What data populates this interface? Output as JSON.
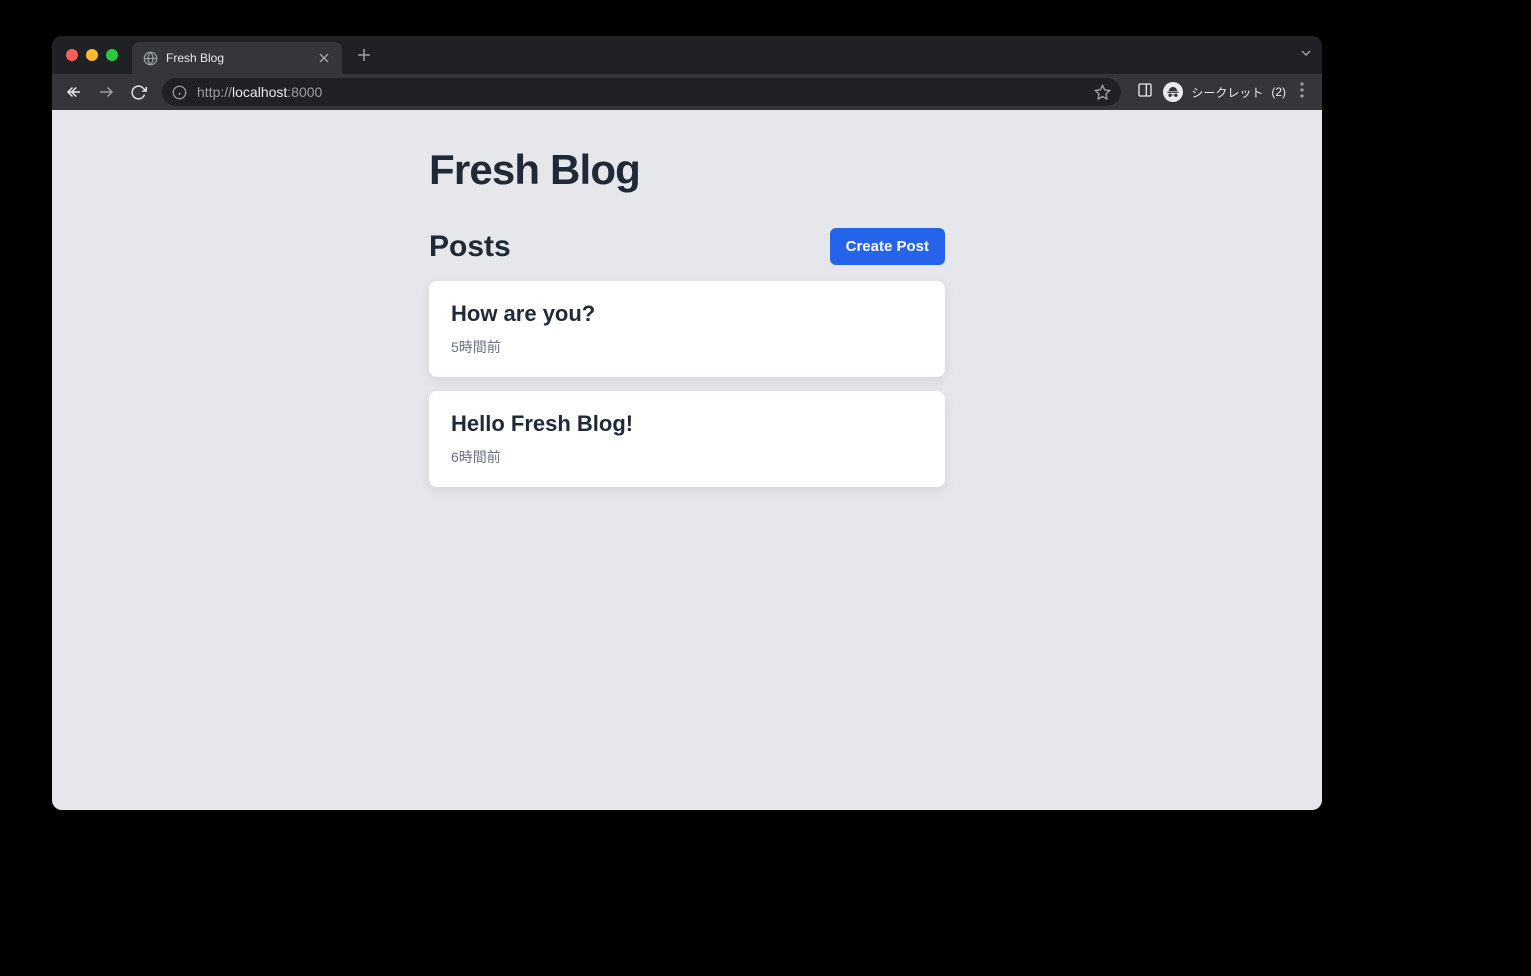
{
  "browser": {
    "tab_title": "Fresh Blog",
    "url_prefix": "http://",
    "url_host": "localhost",
    "url_port": ":8000",
    "incognito_label": "シークレット",
    "incognito_count": "(2)"
  },
  "page": {
    "title": "Fresh Blog",
    "section_heading": "Posts",
    "create_button": "Create Post",
    "posts": [
      {
        "title": "How are you?",
        "time": "5時間前"
      },
      {
        "title": "Hello Fresh Blog!",
        "time": "6時間前"
      }
    ]
  }
}
